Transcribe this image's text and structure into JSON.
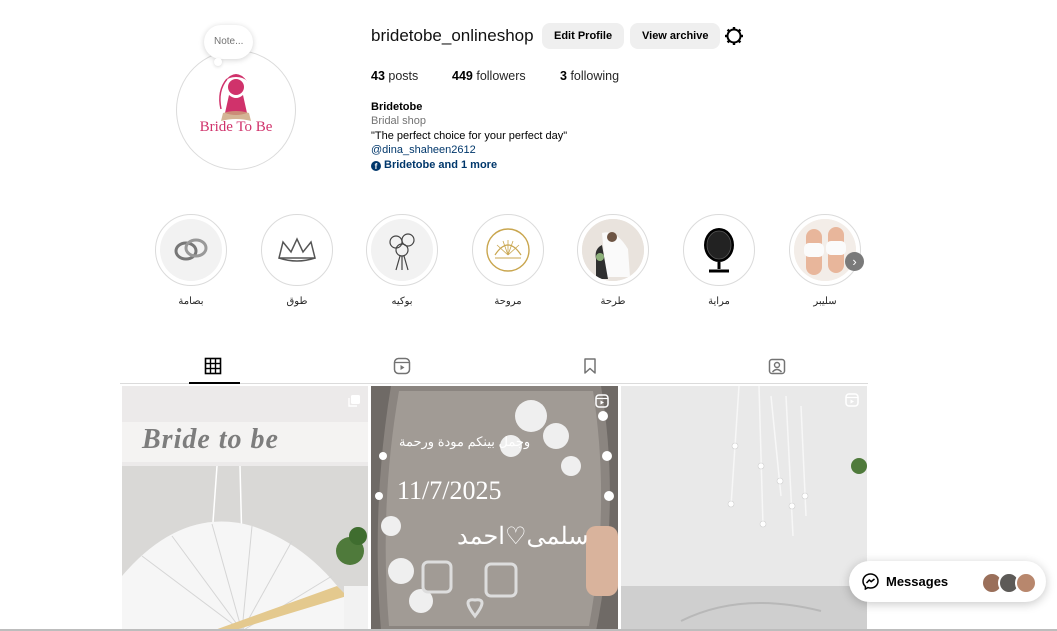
{
  "profile": {
    "note_label": "Note...",
    "logo_text": "Bride To Be",
    "username": "bridetobe_onlineshop",
    "edit_button": "Edit Profile",
    "archive_button": "View archive",
    "posts_count": "43",
    "posts_label": "posts",
    "followers_count": "449",
    "followers_label": "followers",
    "following_count": "3",
    "following_label": "following",
    "bio_name": "Bridetobe",
    "bio_category": "Bridal shop",
    "bio_text": "\"The perfect choice for your perfect day\"",
    "bio_mention": "@dina_shaheen2612",
    "bio_link": "Bridetobe and 1 more"
  },
  "highlights": [
    {
      "label": "بصامة",
      "icon": "rings-icon"
    },
    {
      "label": "طوق",
      "icon": "crown-icon"
    },
    {
      "label": "بوكيه",
      "icon": "bouquet-icon"
    },
    {
      "label": "مروحة",
      "icon": "fan-icon"
    },
    {
      "label": "طرحة",
      "icon": "veil-photo-icon"
    },
    {
      "label": "مراية",
      "icon": "mirror-icon"
    },
    {
      "label": "سليبر",
      "icon": "slippers-photo-icon"
    }
  ],
  "tabs": [
    "posts-grid-tab",
    "reels-tab",
    "saved-tab",
    "tagged-tab"
  ],
  "posts": [
    {
      "banner_text": "Bride to be",
      "badge": "carousel-icon"
    },
    {
      "date_text": "11/7/2025",
      "names_text": "سلمى♡احمد",
      "arabic_line": "وجمل بينكم مودة ورحمة",
      "badge": "reel-icon"
    },
    {
      "badge": "reel-icon"
    }
  ],
  "messages": {
    "label": "Messages"
  },
  "colors": {
    "accent_pink": "#d0326b",
    "link_blue": "#00376b",
    "button_gray": "#efefef"
  }
}
